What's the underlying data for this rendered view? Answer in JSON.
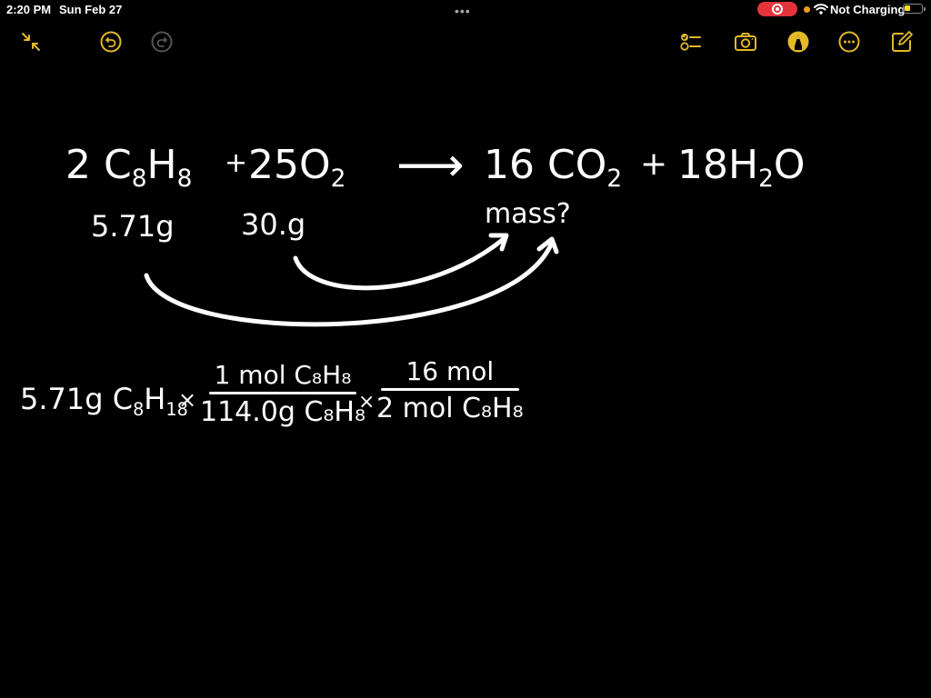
{
  "status_bar": {
    "time": "2:20 PM",
    "date": "Sun Feb 27",
    "multitask": "•••",
    "charging_status": "Not Charging",
    "battery_level": 0.35,
    "icons": [
      "screen-record-icon",
      "mic-indicator-dot",
      "wifi-icon",
      "battery-icon"
    ]
  },
  "toolbar": {
    "left": [
      {
        "name": "collapse-icon",
        "label": "Collapse"
      },
      {
        "name": "undo-icon",
        "label": "Undo"
      },
      {
        "name": "redo-icon",
        "label": "Redo"
      }
    ],
    "right": [
      {
        "name": "checklist-icon",
        "label": "Checklist"
      },
      {
        "name": "camera-icon",
        "label": "Camera"
      },
      {
        "name": "markup-pen-icon",
        "label": "Markup"
      },
      {
        "name": "more-icon",
        "label": "More"
      },
      {
        "name": "compose-icon",
        "label": "New Note"
      }
    ],
    "accent_color": "#e3b927"
  },
  "note": {
    "equation": {
      "reactant1_coef": "2",
      "reactant1": "C",
      "reactant1_sub1": "8",
      "reactant1_h": "H",
      "reactant1_sub2": "8",
      "plus1": "+",
      "reactant2_coef": "25",
      "reactant2": "O",
      "reactant2_sub": "2",
      "arrow": "⟶",
      "product1_coef": "16",
      "product1": "CO",
      "product1_sub": "2",
      "plus2": "+",
      "product2_coef": "18",
      "product2_h": "H",
      "product2_sub": "2",
      "product2_o": "O"
    },
    "given": {
      "reactant1_mass": "5.71g",
      "reactant2_mass": "30.g",
      "product_question": "mass?"
    },
    "calculation": {
      "start": "5.71g C",
      "start_sub1": "8",
      "start_h": "H",
      "start_sub2": "18",
      "times1": "×",
      "frac1_num": "1 mol C₈H₈",
      "frac1_den": "114.0g C₈H₈",
      "times2": "×",
      "frac2_num": "16 mol",
      "frac2_den": "2 mol C₈H₈"
    }
  }
}
